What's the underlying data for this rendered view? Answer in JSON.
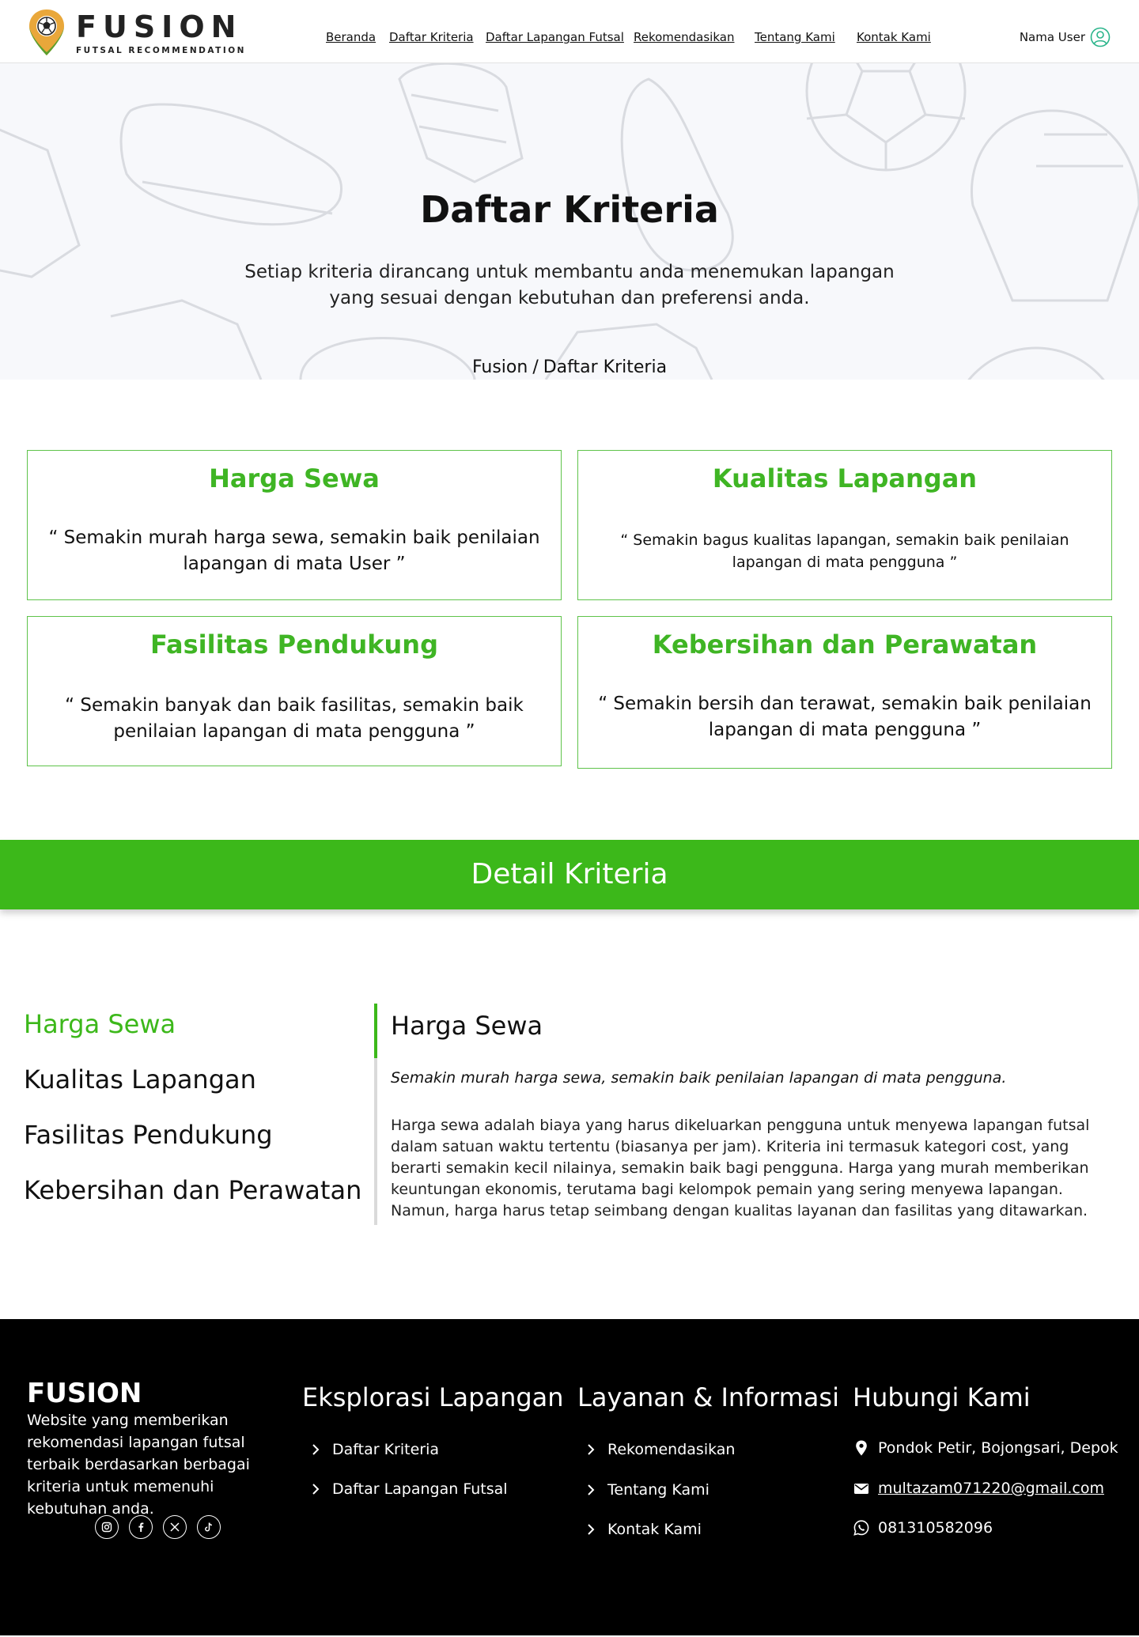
{
  "header": {
    "brand": "FUSION",
    "tagline": "FUTSAL RECOMMENDATION",
    "nav": [
      {
        "label": "Beranda"
      },
      {
        "label": "Daftar Kriteria"
      },
      {
        "label": "Daftar Lapangan Futsal"
      },
      {
        "label": "Rekomendasikan"
      },
      {
        "label": "Tentang Kami"
      },
      {
        "label": "Kontak Kami"
      }
    ],
    "user_name": "Nama User",
    "colors": {
      "accent": "#3cb81a",
      "logo_pin": "#e9a73a",
      "logo_pin_dark": "#5a9f2f",
      "user_icon": "#29b48a"
    }
  },
  "hero": {
    "title": "Daftar Kriteria",
    "description": "Setiap kriteria dirancang untuk membantu anda menemukan lapangan yang sesuai dengan kebutuhan dan preferensi anda.",
    "breadcrumb": {
      "home": "Fusion",
      "separator": "/",
      "current": "Daftar Kriteria"
    }
  },
  "criteria_cards": [
    {
      "title": "Harga Sewa",
      "quote": "“ Semakin murah harga sewa, semakin baik penilaian lapangan di mata User ”"
    },
    {
      "title": "Kualitas Lapangan",
      "quote": "“ Semakin bagus kualitas lapangan, semakin baik penilaian lapangan di mata pengguna ”"
    },
    {
      "title": "Fasilitas Pendukung",
      "quote": "“ Semakin banyak dan baik fasilitas, semakin baik penilaian lapangan di mata pengguna ”"
    },
    {
      "title": "Kebersihan dan Perawatan",
      "quote": "“ Semakin bersih dan terawat, semakin baik penilaian lapangan di mata pengguna ”"
    }
  ],
  "detail": {
    "band_title": "Detail Kriteria",
    "menu": [
      {
        "label": "Harga Sewa",
        "active": true
      },
      {
        "label": "Kualitas Lapangan",
        "active": false
      },
      {
        "label": "Fasilitas Pendukung",
        "active": false
      },
      {
        "label": "Kebersihan dan Perawatan",
        "active": false
      }
    ],
    "heading": "Harga Sewa",
    "quote": "Semakin murah harga sewa, semakin baik penilaian lapangan di mata pengguna.",
    "body": "Harga sewa adalah biaya yang harus dikeluarkan pengguna untuk menyewa lapangan futsal dalam satuan waktu tertentu (biasanya per jam). Kriteria ini termasuk kategori cost, yang berarti semakin kecil nilainya, semakin baik bagi pengguna. Harga yang murah memberikan keuntungan ekonomis, terutama bagi kelompok pemain yang sering menyewa lapangan. Namun, harga harus tetap seimbang dengan kualitas layanan dan fasilitas yang ditawarkan."
  },
  "footer": {
    "brand": "FUSION",
    "description": "Website yang memberikan rekomendasi lapangan futsal terbaik berdasarkan berbagai kriteria untuk memenuhi kebutuhan anda.",
    "socials": [
      "instagram-icon",
      "facebook-icon",
      "x-icon",
      "tiktok-icon"
    ],
    "explore": {
      "title": "Eksplorasi Lapangan",
      "links": [
        "Daftar Kriteria",
        "Daftar Lapangan Futsal"
      ]
    },
    "services": {
      "title": "Layanan & Informasi",
      "links": [
        "Rekomendasikan",
        "Tentang Kami",
        "Kontak Kami"
      ]
    },
    "contact": {
      "title": "Hubungi Kami",
      "address": "Pondok Petir,  Bojongsari, Depok",
      "email": "multazam071220@gmail.com",
      "phone": "081310582096"
    }
  }
}
